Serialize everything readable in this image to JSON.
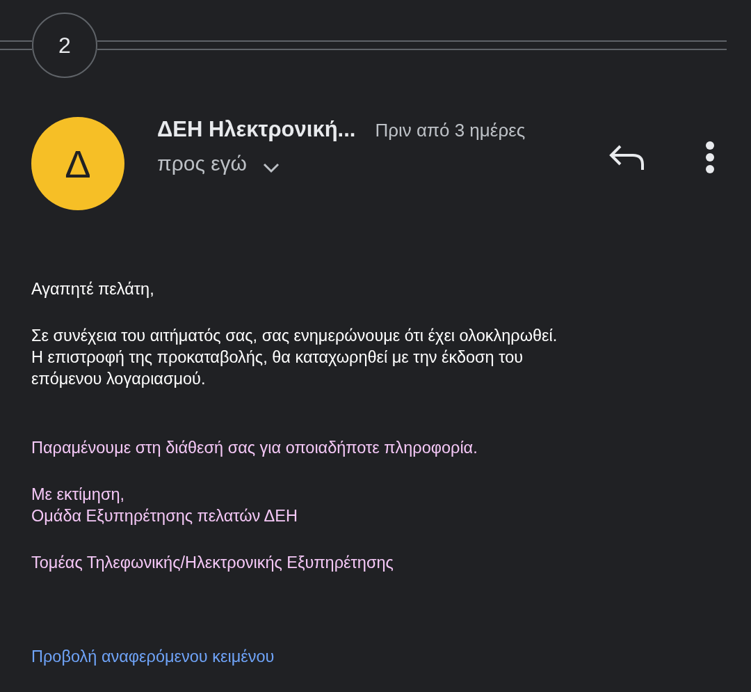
{
  "thread": {
    "collapsed_count": "2"
  },
  "message": {
    "sender": "ΔΕΗ Ηλεκτρονική...",
    "avatar_letter": "Δ",
    "time": "Πριν από 3 ημέρες",
    "recipient": "προς εγώ",
    "expanded": false
  },
  "body": [
    {
      "kind": "plain",
      "lines": [
        "Αγαπητέ πελάτη,"
      ]
    },
    {
      "kind": "plain",
      "lines": [
        "Σε συνέχεια του αιτήματός σας, σας ενημερώνουμε ότι έχει ολοκληρωθεί.",
        "Η επιστροφή της προκαταβολής, θα καταχωρηθεί με την έκδοση του",
        "επόμενου λογαριασμού."
      ]
    },
    {
      "kind": "signature",
      "lines": [
        "Παραμένουμε στη διάθεσή σας για οποιαδήποτε πληροφορία."
      ]
    },
    {
      "kind": "signature",
      "lines": [
        "Με εκτίμηση,",
        "Ομάδα Εξυπηρέτησης πελατών ΔΕΗ"
      ]
    },
    {
      "kind": "signature",
      "lines": [
        "Τομέας Τηλεφωνικής/Ηλεκτρονικής Εξυπηρέτησης"
      ]
    }
  ],
  "quoted_link": "Προβολή αναφερόμενου κειμένου"
}
